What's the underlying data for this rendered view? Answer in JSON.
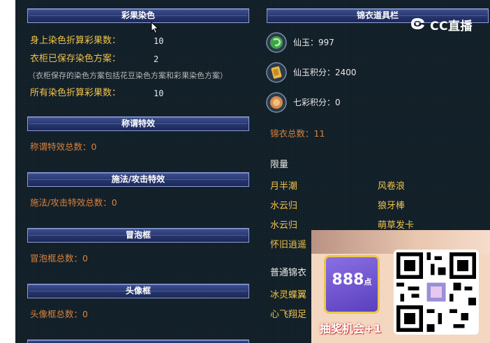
{
  "left": {
    "dye": {
      "header": "彩果染色",
      "rows": [
        {
          "label": "身上染色折算彩果数：",
          "value": "10"
        },
        {
          "label": "衣柜已保存染色方案：",
          "value": "2"
        }
      ],
      "note": "（衣柜保存的染色方案包括花豆染色方案和彩果染色方案）",
      "total": {
        "label": "所有染色折算彩果数：",
        "value": "10"
      }
    },
    "title_effect": {
      "header": "称谓特效",
      "text": "称谓特效总数：0"
    },
    "cast_effect": {
      "header": "施法/攻击特效",
      "text": "施法/攻击特效总数：0"
    },
    "bubble": {
      "header": "冒泡框",
      "text": "冒泡框总数：0"
    },
    "avatar_frame": {
      "header": "头像框",
      "text": "头像框总数：0"
    }
  },
  "right": {
    "header": "锦衣道具栏",
    "currencies": [
      {
        "text": "仙玉：997",
        "icon": "jade-icon"
      },
      {
        "text": "仙玉积分：2400",
        "icon": "jade-points-icon"
      },
      {
        "text": "七彩积分：0",
        "icon": "rainbow-points-icon"
      }
    ],
    "total": "锦衣总数：11",
    "limited_label": "限量",
    "limited_items": [
      "月半潮",
      "风卷浪",
      "水云归",
      "狼牙棒",
      "水云归",
      "萌草发卡",
      "怀旧逍遥"
    ],
    "normal_label": "普通锦衣",
    "normal_items": [
      "冰灵蝶翼",
      "心飞翔足"
    ]
  },
  "watermark": {
    "text": "CC直播"
  },
  "ad": {
    "value": "888",
    "unit": "点",
    "label": "抽奖机会+1"
  },
  "colors": {
    "background": "#122029",
    "header_bar": "#25346b",
    "label_yellow": "#f0c24a",
    "label_orange": "#d9823c"
  }
}
